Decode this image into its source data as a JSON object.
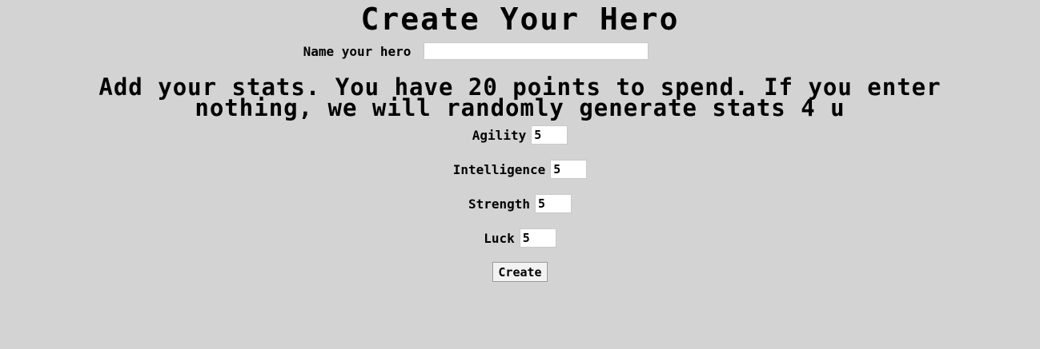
{
  "page": {
    "title": "Create Your Hero"
  },
  "name_field": {
    "label": "Name your hero",
    "value": ""
  },
  "stats_section": {
    "heading": "Add your stats. You have 20 points to spend. If you enter nothing, we will randomly generate stats 4 u"
  },
  "stats": {
    "agility": {
      "label": "Agility",
      "value": "5"
    },
    "intelligence": {
      "label": "Intelligence",
      "value": "5"
    },
    "strength": {
      "label": "Strength",
      "value": "5"
    },
    "luck": {
      "label": "Luck",
      "value": "5"
    }
  },
  "actions": {
    "create_label": "Create"
  },
  "colors": {
    "background": "#d3d3d3",
    "input_background": "#ffffff"
  }
}
